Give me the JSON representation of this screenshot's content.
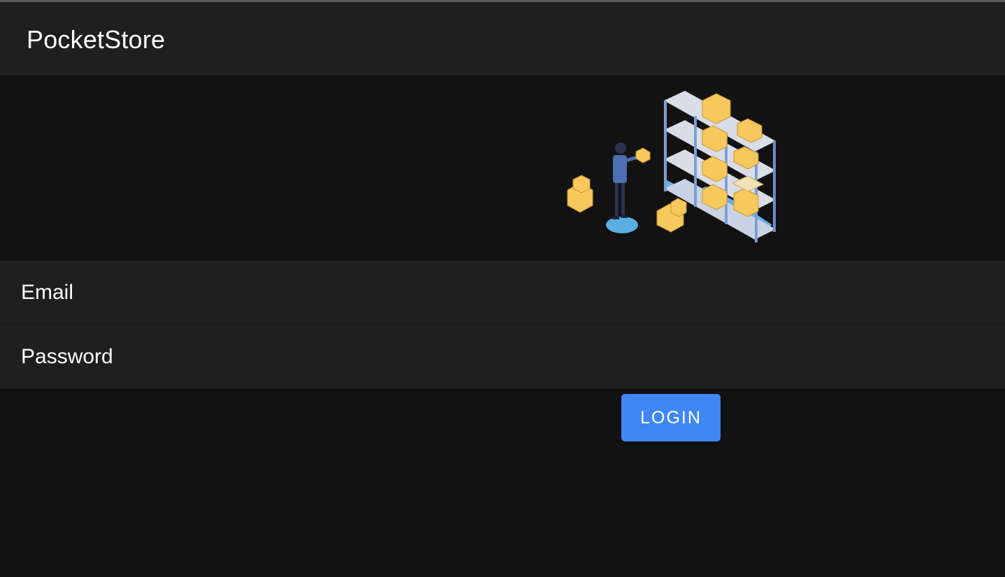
{
  "app": {
    "title": "PocketStore"
  },
  "hero": {
    "illustration": "warehouse-worker-with-shelves-and-boxes"
  },
  "form": {
    "email_placeholder": "Email",
    "email_value": "",
    "password_placeholder": "Password",
    "password_value": "",
    "login_label": "LOGIN"
  },
  "colors": {
    "app_bar": "#1f1f1f",
    "background": "#121212",
    "field": "#1f1f1f",
    "button": "#3f87f5",
    "shelf": "#7b9fd4",
    "box": "#f7c85c",
    "worker_shirt": "#4b6fb0",
    "floor_spot": "#5aaee0"
  }
}
